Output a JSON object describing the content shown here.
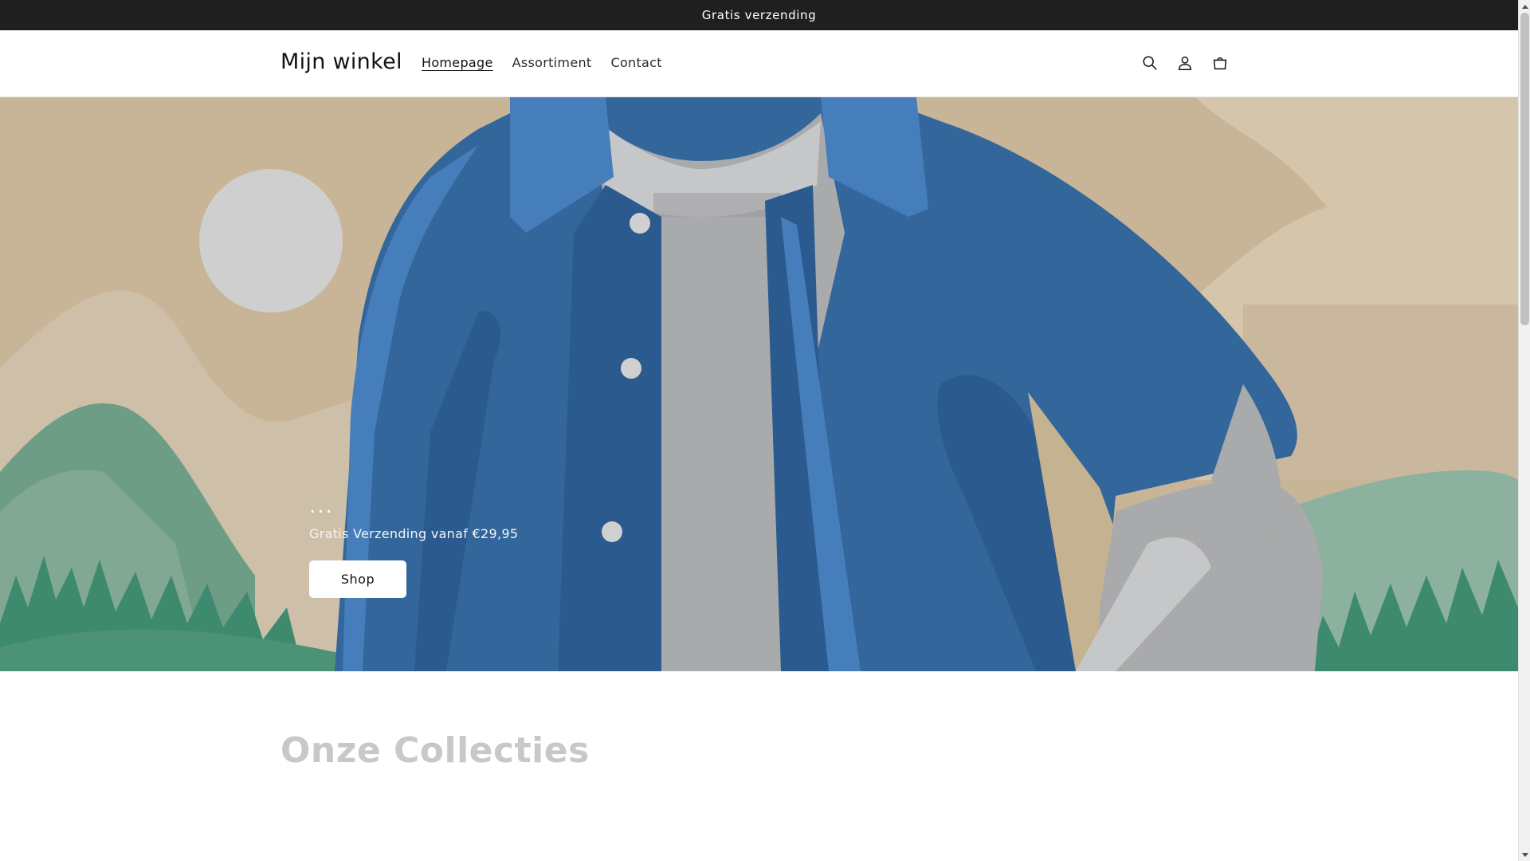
{
  "announcement": {
    "text": "Gratis verzending"
  },
  "header": {
    "logo": "Mijn winkel",
    "nav": [
      {
        "label": "Homepage",
        "active": true
      },
      {
        "label": "Assortiment",
        "active": false
      },
      {
        "label": "Contact",
        "active": false
      }
    ],
    "icons": [
      "search-icon",
      "account-icon",
      "cart-icon"
    ]
  },
  "hero": {
    "heading": "...",
    "subtext": "Gratis Verzending vanaf €29,95",
    "button_label": "Shop"
  },
  "collections": {
    "title": "Onze Collecties"
  },
  "colors": {
    "announcement_bg": "#1f1f1f",
    "jacket_blue": "#33679b",
    "sand": "#c6b497",
    "forest": "#3e8a6e"
  }
}
